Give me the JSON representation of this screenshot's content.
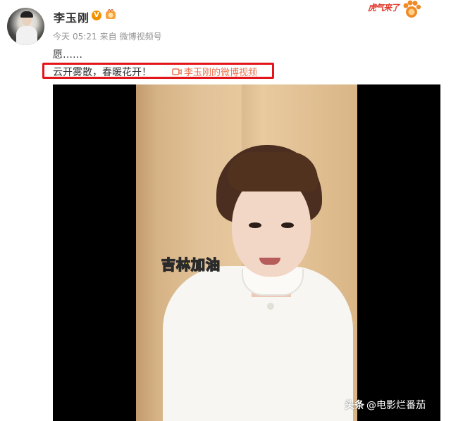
{
  "post": {
    "username": "李玉刚",
    "verified_badge": "V",
    "meta": {
      "time_prefix": "今天",
      "time": "05:21",
      "source_prefix": "来自",
      "source": "微博视频号"
    },
    "text_line1": "愿……",
    "text_line2": "云开雾散，春暖花开！",
    "video_link_label": "李玉刚的微博视频"
  },
  "corner_sticker": {
    "text": "虎气来了"
  },
  "video": {
    "caption": "吉林加油"
  },
  "watermark": {
    "brand": "头条",
    "handle": "@电影烂番茄"
  },
  "colors": {
    "highlight_border": "#e3141a",
    "link": "#eb7350",
    "verified": "#f29100",
    "caption_fill": "#f5e41c",
    "meta_text": "#939393"
  },
  "icons": [
    "avatar",
    "verified-badge-icon",
    "medal-icon",
    "video-camera-icon",
    "tiger-paw-sticker-icon"
  ]
}
